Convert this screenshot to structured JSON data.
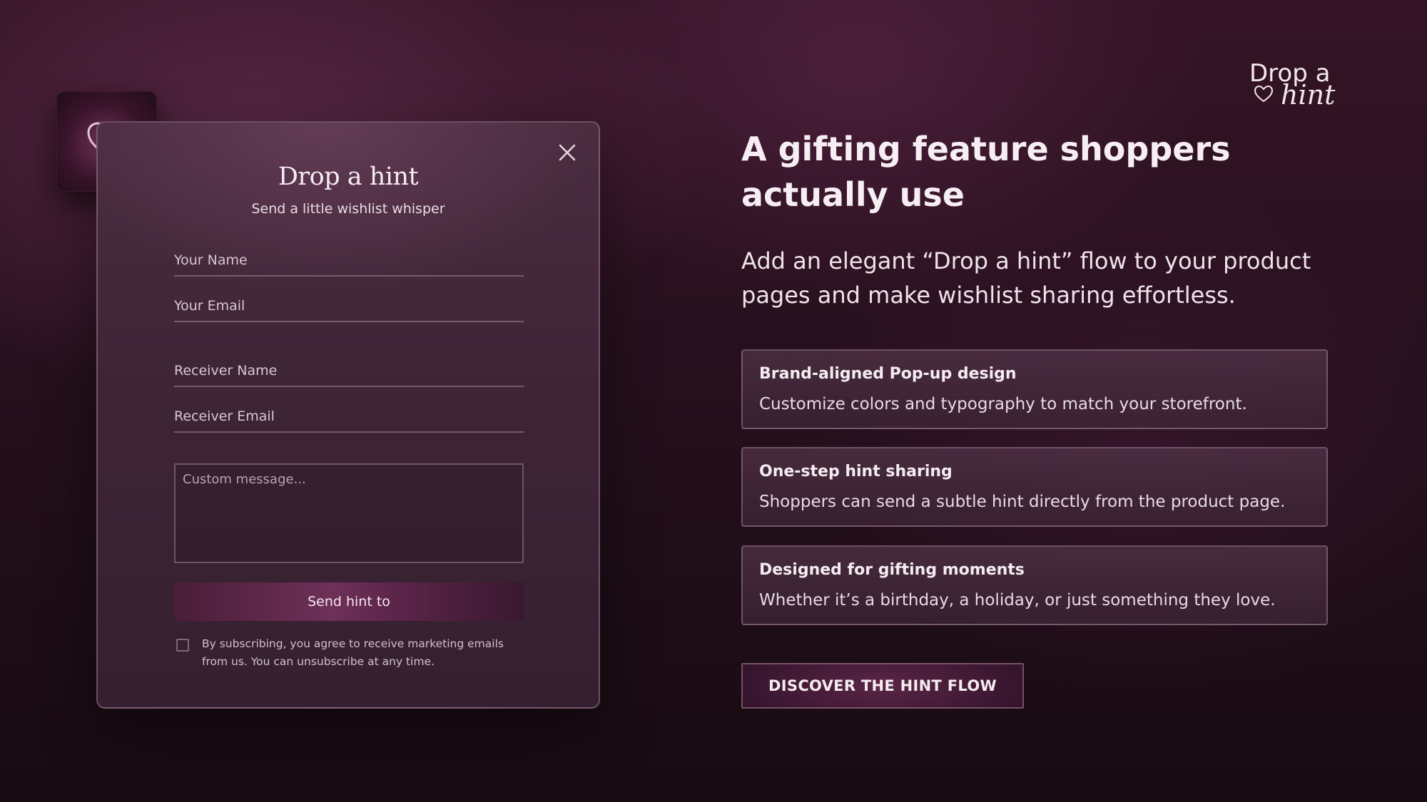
{
  "brand": {
    "logo_line1": "Drop a",
    "logo_line2": "hint"
  },
  "modal": {
    "title": "Drop a hint",
    "subtitle": "Send a little wishlist whisper",
    "fields": {
      "your_name": "Your Name",
      "your_email": "Your Email",
      "receiver_name": "Receiver Name",
      "receiver_email": "Receiver Email"
    },
    "message_placeholder": "Custom message...",
    "send_button": "Send hint to",
    "consent": "By subscribing, you agree to receive marketing emails from us. You can unsubscribe at any time.",
    "consent_checked": false
  },
  "hero": {
    "title": "A gifting feature shoppers actually use",
    "description": "Add an elegant “Drop a hint” flow to your product pages and make wishlist sharing effortless."
  },
  "features": [
    {
      "title": "Brand-aligned Pop-up design",
      "description": "Customize colors and typography to match your storefront."
    },
    {
      "title": "One-step hint sharing",
      "description": "Shoppers can send a subtle hint directly from the product page."
    },
    {
      "title": "Designed for gifting moments",
      "description": "Whether it’s a birthday, a holiday, or just something they love."
    }
  ],
  "cta": {
    "label": "DISCOVER THE HINT FLOW"
  },
  "icons": {
    "close": "close-icon",
    "heart": "heart-icon",
    "logo_heart": "heart-icon"
  },
  "colors": {
    "background": "#26101d",
    "modal_surface": "#3e2536",
    "accent": "#6e3058",
    "text": "#f5ecf1"
  }
}
